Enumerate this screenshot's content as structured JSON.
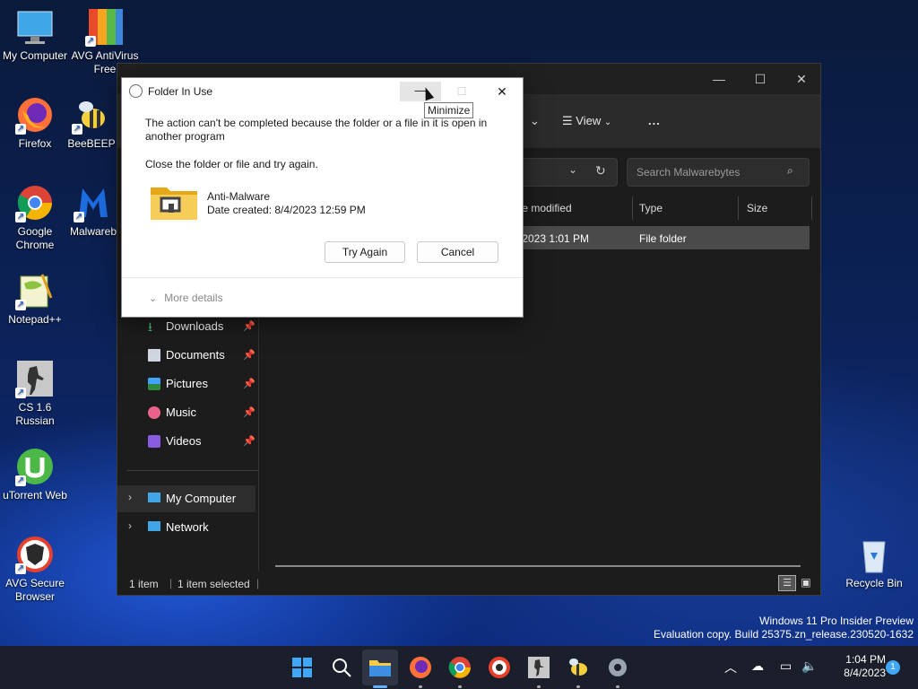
{
  "desktop": {
    "icons": [
      {
        "label": "My Computer"
      },
      {
        "label": "AVG AntiVirus Free"
      },
      {
        "label": "Firefox"
      },
      {
        "label": "BeeBEEP"
      },
      {
        "label": "Google Chrome"
      },
      {
        "label": "Malwarebytes"
      },
      {
        "label": "Notepad++"
      },
      {
        "label": "CS 1.6 Russian"
      },
      {
        "label": "uTorrent Web"
      },
      {
        "label": "AVG Secure Browser"
      },
      {
        "label": "Recycle Bin"
      }
    ],
    "watermark_line1": "Windows 11 Pro Insider Preview",
    "watermark_line2": "Evaluation copy. Build 25375.zn_release.230520-1632"
  },
  "explorer": {
    "toolbar": {
      "view_label": "View",
      "more_label": "..."
    },
    "search_placeholder": "Search Malwarebytes",
    "columns": {
      "date_modified": "te modified",
      "type": "Type",
      "size": "Size"
    },
    "row": {
      "date": "/2023 1:01 PM",
      "type": "File folder"
    },
    "nav": [
      {
        "label": "Downloads"
      },
      {
        "label": "Documents"
      },
      {
        "label": "Pictures"
      },
      {
        "label": "Music"
      },
      {
        "label": "Videos"
      },
      {
        "label": "My Computer"
      },
      {
        "label": "Network"
      }
    ],
    "status": {
      "count": "1 item",
      "selected": "1 item selected"
    }
  },
  "dialog": {
    "title": "Folder In Use",
    "message": "The action can't be completed because the folder or a file in it is open in another program",
    "instruction": "Close the folder or file and try again.",
    "item_name": "Anti-Malware",
    "item_date": "Date created: 8/4/2023 12:59 PM",
    "try_again": "Try Again",
    "cancel": "Cancel",
    "more_details": "More details",
    "tooltip": "Minimize"
  },
  "taskbar": {
    "time": "1:04 PM",
    "date": "8/4/2023",
    "notification_count": "1"
  },
  "colors": {
    "accent": "#0067c0",
    "folder": "#f5c542",
    "selected_row": "#4a4a4a"
  }
}
